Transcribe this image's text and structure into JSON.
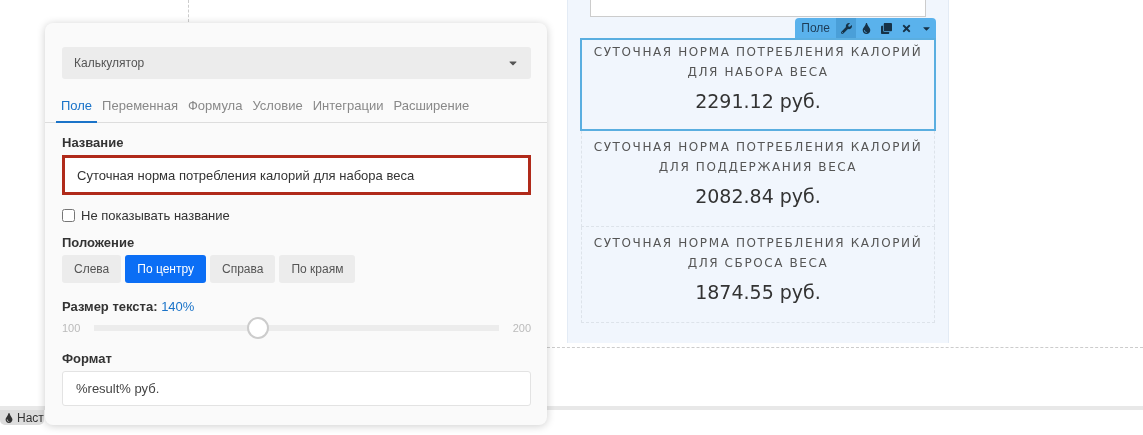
{
  "canvas": {
    "toolbar": {
      "label": "Поле",
      "tools": [
        {
          "kind": "wrench",
          "selected": true
        },
        {
          "kind": "drop",
          "selected": false
        },
        {
          "kind": "copy",
          "selected": false
        },
        {
          "kind": "close",
          "selected": false
        },
        {
          "kind": "caret",
          "selected": false
        }
      ]
    },
    "cards": [
      {
        "title": "СУТОЧНАЯ НОРМА ПОТРЕБЛЕНИЯ КАЛОРИЙ ДЛЯ НАБОРА ВЕСА",
        "value": "2291.12 руб.",
        "selected": true
      },
      {
        "title": "СУТОЧНАЯ НОРМА ПОТРЕБЛЕНИЯ КАЛОРИЙ ДЛЯ ПОДДЕРЖАНИЯ ВЕСА",
        "value": "2082.84 руб.",
        "selected": false
      },
      {
        "title": "СУТОЧНАЯ НОРМА ПОТРЕБЛЕНИЯ КАЛОРИЙ ДЛЯ СБРОСА ВЕСА",
        "value": "1874.55 руб.",
        "selected": false
      }
    ]
  },
  "panel": {
    "dropdown": "Калькулятор",
    "tabs": [
      {
        "label": "Поле",
        "selected": true
      },
      {
        "label": "Переменная",
        "selected": false
      },
      {
        "label": "Формула",
        "selected": false
      },
      {
        "label": "Условие",
        "selected": false
      },
      {
        "label": "Интеграции",
        "selected": false
      },
      {
        "label": "Расширение",
        "selected": false
      }
    ],
    "name": {
      "label": "Название",
      "value": "Суточная норма потребления калорий для набора веса",
      "highlighted": true
    },
    "hide_name": {
      "label": "Не показывать название",
      "checked": false
    },
    "position": {
      "label": "Положение",
      "options": [
        {
          "label": "Слева",
          "selected": false
        },
        {
          "label": "По центру",
          "selected": true
        },
        {
          "label": "Справа",
          "selected": false
        },
        {
          "label": "По краям",
          "selected": false
        }
      ]
    },
    "text_size": {
      "label": "Размер текста:",
      "value": "140%",
      "min": "100",
      "max": "200",
      "level": 0.4
    },
    "format": {
      "label": "Формат",
      "value": "%result% руб."
    }
  },
  "bottom_bar": {
    "label": "Наст"
  }
}
